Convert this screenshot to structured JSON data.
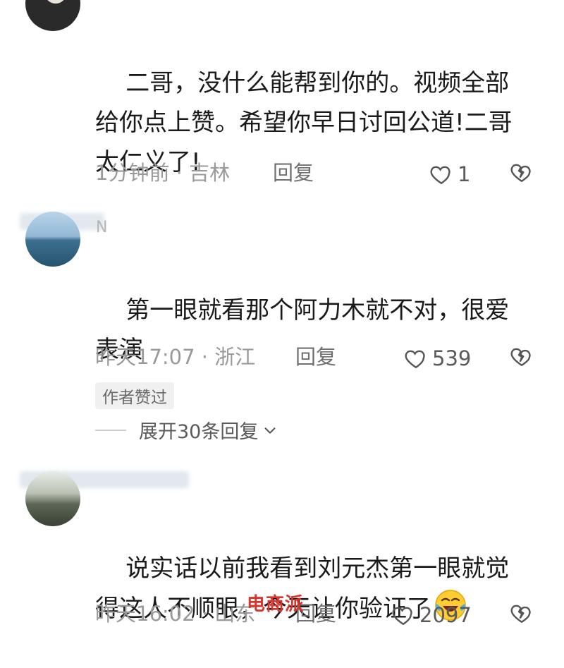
{
  "comments": [
    {
      "text": "二哥，没什么能帮到你的。视频全部给你点上赞。希望你早日讨回公道!二哥太仁义了!",
      "time_location": "1分钟前 · 吉林",
      "reply_label": "回复",
      "likes": "1"
    },
    {
      "nickname_fragment": "N",
      "text": "第一眼就看那个阿力木就不对，很爱表演",
      "time_location": "昨天17:07 · 浙江",
      "reply_label": "回复",
      "likes": "539",
      "author_tag": "作者赞过",
      "expand_label": "展开30条回复"
    },
    {
      "text": "说实话以前我看到刘元杰第一眼就觉得这人不顺眼，今天让你验证了",
      "time_location": "昨天16:02 · 山东",
      "reply_label": "回复",
      "likes": "2097"
    }
  ],
  "watermark": "电商派",
  "icons": {
    "like": "heart-outline-icon",
    "dislike": "broken-heart-icon",
    "expand": "chevron-down-icon",
    "emoji": "laughing-crying-emoji-icon"
  },
  "colors": {
    "meta": "#9a9a9a",
    "text": "#1a1a1a",
    "watermark": "#d9342b"
  }
}
